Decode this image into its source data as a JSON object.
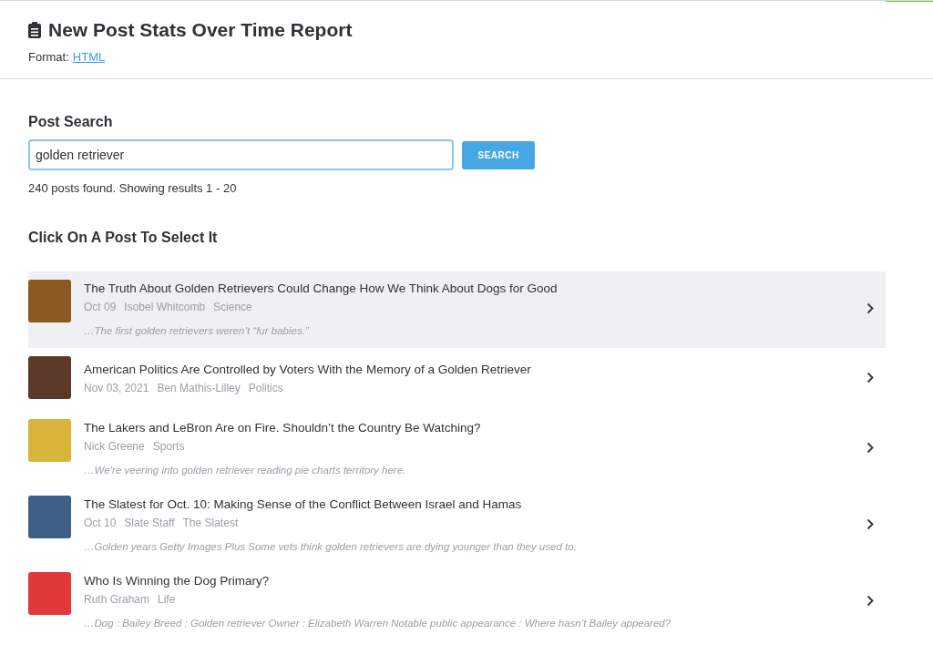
{
  "report": {
    "title": "New Post Stats Over Time Report",
    "format_label": "Format:",
    "format_link": "HTML"
  },
  "search": {
    "heading": "Post Search",
    "value": "golden retriever",
    "button": "SEARCH",
    "result_summary": "240 posts found. Showing results 1 - 20"
  },
  "posts_heading": "Click On A Post To Select It",
  "posts": [
    {
      "title": "The Truth About Golden Retrievers Could Change How We Think About Dogs for Good",
      "meta": [
        "Oct 09",
        "Isobel Whitcomb",
        "Science"
      ],
      "snippet": "…The first golden retrievers weren’t “fur babies.”",
      "selected": true
    },
    {
      "title": "American Politics Are Controlled by Voters With the Memory of a Golden Retriever",
      "meta": [
        "Nov 03, 2021",
        "Ben Mathis-Lilley",
        "Politics"
      ],
      "selected": false
    },
    {
      "title": "The Lakers and LeBron Are on Fire. Shouldn’t the Country Be Watching?",
      "meta": [
        "Nick Greene",
        "Sports"
      ],
      "snippet": "…We’re veering into golden retriever reading pie charts territory here.",
      "selected": false
    },
    {
      "title": "The Slatest for Oct. 10: Making Sense of the Conflict Between Israel and Hamas",
      "meta": [
        "Oct 10",
        "Slate Staff",
        "The Slatest"
      ],
      "snippet": "…Golden years Getty Images Plus Some vets think golden retrievers are dying younger than they used to.",
      "selected": false
    },
    {
      "title": "Who Is Winning the Dog Primary?",
      "meta": [
        "Ruth Graham",
        "Life"
      ],
      "snippet": "…Dog : Bailey Breed : Golden retriever Owner : Elizabeth Warren Notable public appearance : Where hasn’t Bailey appeared?",
      "selected": false
    }
  ]
}
